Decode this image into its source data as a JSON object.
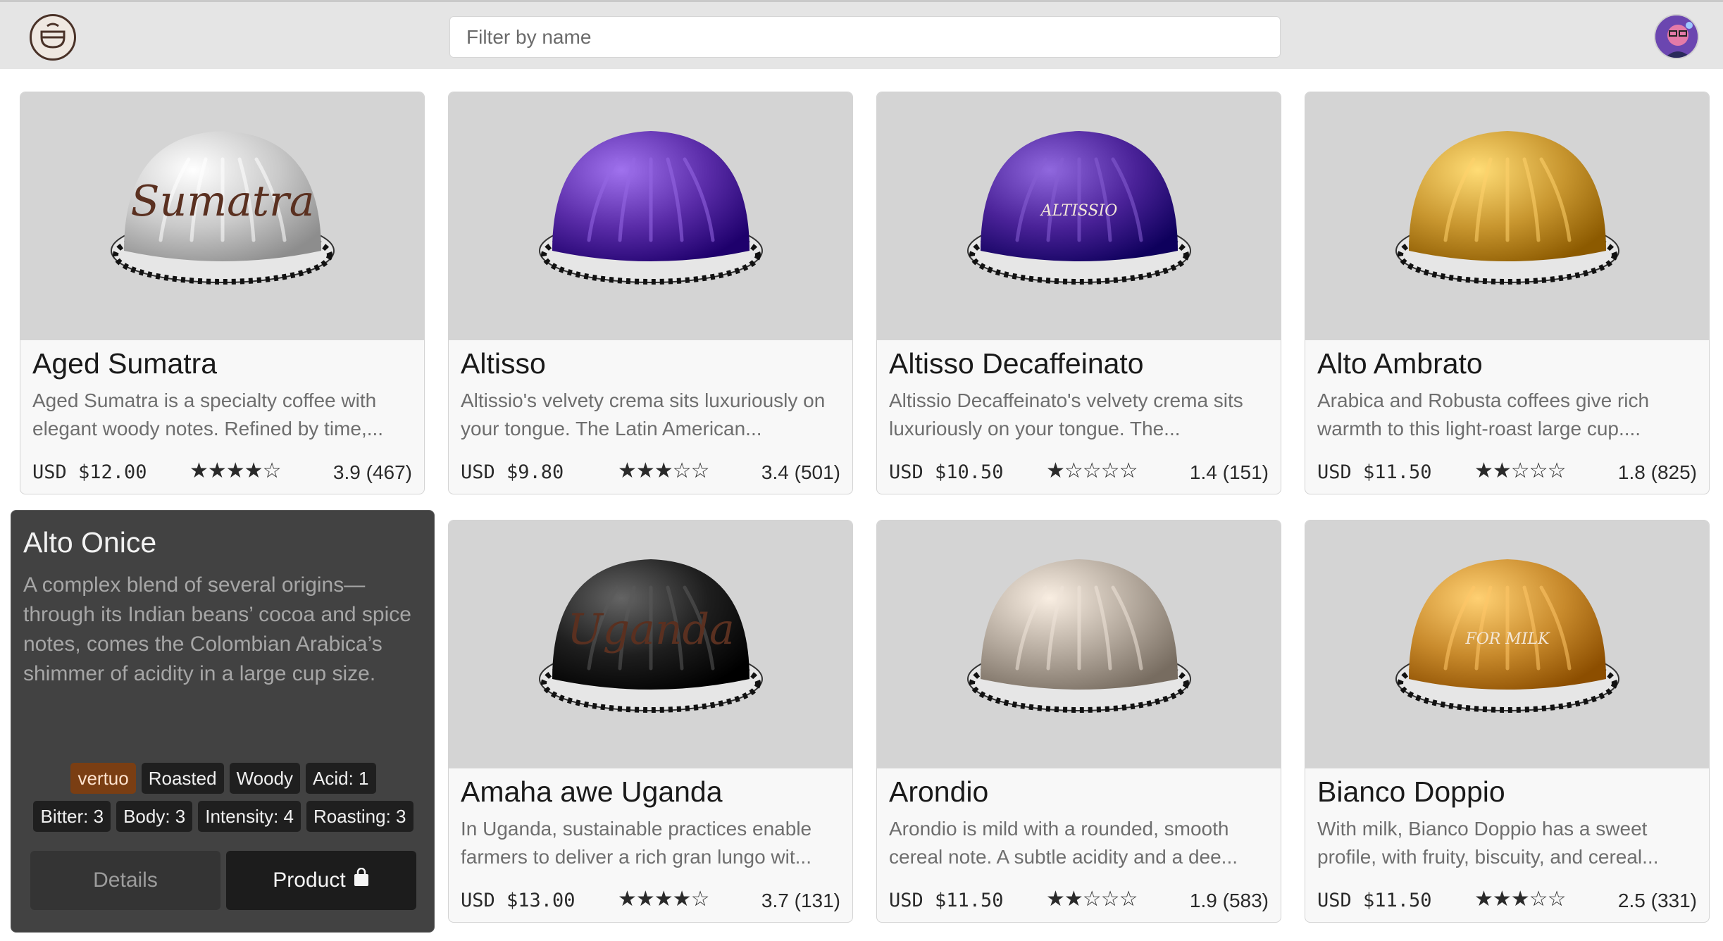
{
  "header": {
    "logo_icon": "coffee-cup-logo-icon",
    "search_placeholder": "Filter by name",
    "avatar_icon": "user-avatar-icon"
  },
  "products": [
    {
      "name": "Aged Sumatra",
      "description": "Aged Sumatra is a specialty coffee with elegant woody notes. Refined by time,...",
      "price": "USD $12.00",
      "stars": "★★★★☆",
      "rating": "3.9 (467)",
      "capsule_color": "#c9c9c9",
      "capsule_label": "Sumatra"
    },
    {
      "name": "Altisso",
      "description": "Altissio's velvety crema sits luxuriously on your tongue. The Latin American...",
      "price": "USD $9.80",
      "stars": "★★★☆☆",
      "rating": "3.4 (501)",
      "capsule_color": "#5a2ca8",
      "capsule_label": ""
    },
    {
      "name": "Altisso Decaffeinato",
      "description": "Altissio Decaffeinato's velvety crema sits luxuriously on your tongue. The...",
      "price": "USD $10.50",
      "stars": "★☆☆☆☆",
      "rating": "1.4 (151)",
      "capsule_color": "#4a2298",
      "capsule_label": "ALTISSIO"
    },
    {
      "name": "Alto Ambrato",
      "description": "Arabica and Robusta coffees give rich warmth to this light-roast large cup....",
      "price": "USD $11.50",
      "stars": "★★☆☆☆",
      "rating": "1.8 (825)",
      "capsule_color": "#c8962f",
      "capsule_label": ""
    },
    {
      "name": "Amaha awe Uganda",
      "description": "In Uganda, sustainable practices enable farmers to deliver a rich gran lungo wit...",
      "price": "USD $13.00",
      "stars": "★★★★☆",
      "rating": "3.7 (131)",
      "capsule_color": "#1e1e1e",
      "capsule_label": "Uganda"
    },
    {
      "name": "Arondio",
      "description": "Arondio is mild with a rounded, smooth cereal note. A subtle acidity and a dee...",
      "price": "USD $11.50",
      "stars": "★★☆☆☆",
      "rating": "1.9 (583)",
      "capsule_color": "#b3a89c",
      "capsule_label": ""
    },
    {
      "name": "Bianco Doppio",
      "description": "With milk, Bianco Doppio has a sweet profile, with fruity, biscuity, and cereal...",
      "price": "USD $11.50",
      "stars": "★★★☆☆",
      "rating": "2.5 (331)",
      "capsule_color": "#c88a2c",
      "capsule_label": "FOR MILK"
    }
  ],
  "detail": {
    "name": "Alto Onice",
    "description": "A complex blend of several origins—through its Indian beans’ cocoa and spice notes, comes the Colombian Arabica’s shimmer of acidity in a large cup size.",
    "tags_row1": [
      "vertuo",
      "Roasted",
      "Woody",
      "Acid: 1"
    ],
    "tags_row2": [
      "Bitter: 3",
      "Body: 3",
      "Intensity: 4",
      "Roasting: 3"
    ],
    "details_label": "Details",
    "product_label": "Product",
    "product_icon": "shopping-bag-icon"
  }
}
